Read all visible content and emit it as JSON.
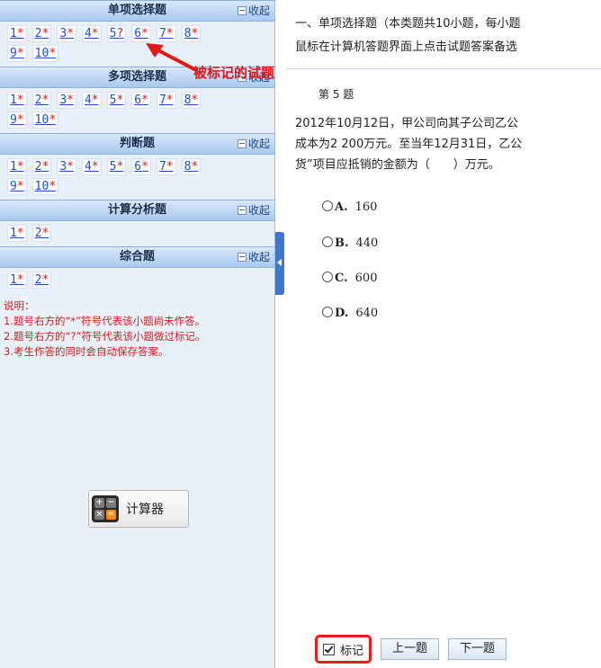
{
  "sidebar": {
    "sections": [
      {
        "title": "单项选择题",
        "collapse": "收起",
        "rows": [
          [
            "1*",
            "2*",
            "3*",
            "4*",
            "5?",
            "6*",
            "7*",
            "8*"
          ],
          [
            "9*",
            "10*"
          ]
        ]
      },
      {
        "title": "多项选择题",
        "collapse": "收起",
        "rows": [
          [
            "1*",
            "2*",
            "3*",
            "4*",
            "5*",
            "6*",
            "7*",
            "8*"
          ],
          [
            "9*",
            "10*"
          ]
        ]
      },
      {
        "title": "判断题",
        "collapse": "收起",
        "rows": [
          [
            "1*",
            "2*",
            "3*",
            "4*",
            "5*",
            "6*",
            "7*",
            "8*"
          ],
          [
            "9*",
            "10*"
          ]
        ]
      },
      {
        "title": "计算分析题",
        "collapse": "收起",
        "rows": [
          [
            "1*",
            "2*"
          ]
        ]
      },
      {
        "title": "综合题",
        "collapse": "收起",
        "rows": [
          [
            "1*",
            "2*"
          ]
        ]
      }
    ],
    "notes": [
      "说明：",
      "1.题号右方的“*”符号代表该小题尚未作答。",
      "2.题号右方的“?”符号代表该小题做过标记。",
      "3.考生作答的同时会自动保存答案。"
    ],
    "calculator_label": "计算器",
    "annotation": "被标记的试题"
  },
  "main": {
    "instructions": [
      "一、单项选择题（本类题共10小题，每小题",
      "鼠标在计算机答题界面上点击试题答案备选"
    ],
    "question_title": "第 5 题",
    "stem": [
      "2012年10月12日，甲公司向其子公司乙公",
      "成本为2 200万元。至当年12月31日，乙公",
      "货”项目应抵销的金额为（　　）万元。"
    ],
    "options": [
      {
        "letter": "A.",
        "value": "160"
      },
      {
        "letter": "B.",
        "value": "440"
      },
      {
        "letter": "C.",
        "value": "600"
      },
      {
        "letter": "D.",
        "value": "640"
      }
    ],
    "buttons": {
      "mark": "标记",
      "prev": "上一题",
      "next": "下一题"
    }
  }
}
